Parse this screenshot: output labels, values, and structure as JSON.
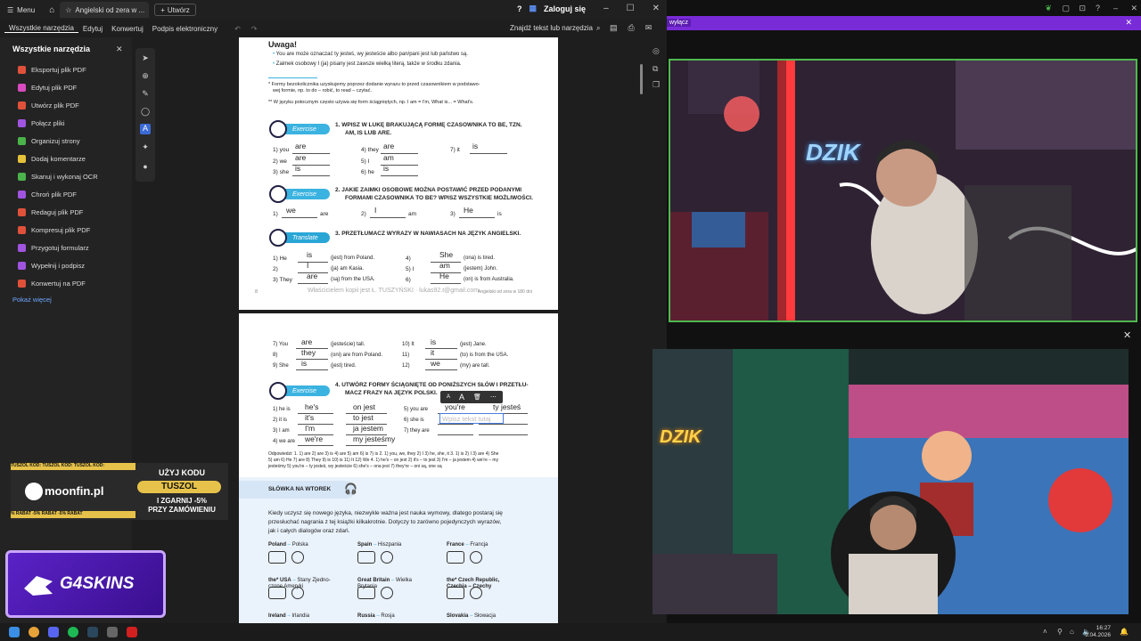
{
  "window": {
    "menu_label": "Menu",
    "tab_title": "Angielski od zera w ...",
    "new_tab_label": "Utwórz",
    "login_label": "Zaloguj się"
  },
  "toolbar": {
    "tabs": [
      "Wszystkie narzędzia",
      "Edytuj",
      "Konwertuj",
      "Podpis elektroniczny"
    ],
    "search_label": "Znajdź tekst lub narzędzia"
  },
  "panel": {
    "title": "Wszystkie narzędzia",
    "items": [
      {
        "label": "Eksportuj plik PDF",
        "color": "#e0513a"
      },
      {
        "label": "Edytuj plik PDF",
        "color": "#d94ac0"
      },
      {
        "label": "Utwórz plik PDF",
        "color": "#e0513a"
      },
      {
        "label": "Połącz pliki",
        "color": "#a154e0"
      },
      {
        "label": "Organizuj strony",
        "color": "#4ab34a"
      },
      {
        "label": "Dodaj komentarze",
        "color": "#e6c23a"
      },
      {
        "label": "Skanuj i wykonaj OCR",
        "color": "#4ab34a"
      },
      {
        "label": "Chroń plik PDF",
        "color": "#a154e0"
      },
      {
        "label": "Redaguj plik PDF",
        "color": "#e0513a"
      },
      {
        "label": "Kompresuj plik PDF",
        "color": "#e0513a"
      },
      {
        "label": "Przygotuj formularz",
        "color": "#a154e0"
      },
      {
        "label": "Wypełnij i podpisz",
        "color": "#a154e0"
      },
      {
        "label": "Konwertuj na PDF",
        "color": "#e0513a"
      }
    ],
    "more_label": "Pokaż więcej"
  },
  "page1": {
    "heading": "Uwaga!",
    "note1": "You are może oznaczać ty jesteś, wy jesteście albo pan/pani jest lub państwo są.",
    "note2": "Zaimek osobowy I (ja) pisany jest zawsze wielką literą, także w środku zdania.",
    "foot1a": "* Formy bezokolicznika uzyskujemy poprzez dodanie wyrazu to przed czasownikiem w podstawo-",
    "foot1b": "wej formie, np. to do – robić, to read – czytać.",
    "foot2": "** W języku potocznym często używa się form ściągniętych, np. I am = I'm, What is... = What's.",
    "ex1_badge": "Exercise",
    "ex1_title_a": "1. WPISZ W LUKĘ BRAKUJĄCĄ FORMĘ CZASOWNIKA TO BE, TZN.",
    "ex1_title_b": "AM, IS LUB ARE.",
    "ex1_rows": [
      {
        "label": "1) you",
        "answer": "are"
      },
      {
        "label": "2) we",
        "answer": "are"
      },
      {
        "label": "3) she",
        "answer": "is"
      },
      {
        "label": "4) they",
        "answer": "are"
      },
      {
        "label": "5) I",
        "answer": "am"
      },
      {
        "label": "6) he",
        "answer": "is"
      },
      {
        "label": "7) it",
        "answer": "is"
      }
    ],
    "ex2_badge": "Exercise",
    "ex2_title_a": "2. JAKIE ZAIMKI OSOBOWE MOŻNA POSTAWIĆ PRZED PODANYMI",
    "ex2_title_b": "FORMAMI CZASOWNIKA TO BE? WPISZ WSZYSTKIE MOŻLIWOŚCI.",
    "ex2_rows": [
      {
        "label": "1)",
        "answer": "we",
        "tail": "are"
      },
      {
        "label": "2)",
        "answer": "I",
        "tail": "am"
      },
      {
        "label": "3)",
        "answer": "He",
        "tail": "is"
      }
    ],
    "ex3_badge": "Translate",
    "ex3_title": "3. PRZETŁUMACZ WYRAZY W NAWIASACH NA JĘZYK ANGIELSKI.",
    "ex3_rows": [
      {
        "pre": "1) He",
        "answer": "is",
        "post": "(jest) from Poland."
      },
      {
        "pre": "2)",
        "answer": "I",
        "post": "(ja) am Kasia."
      },
      {
        "pre": "3) They",
        "answer": "are",
        "post": "(są) from the USA."
      },
      {
        "pre": "4)",
        "answer": "She",
        "post": "(ona) is tired."
      },
      {
        "pre": "5) I",
        "answer": "am",
        "post": "(jestem) John."
      },
      {
        "pre": "6)",
        "answer": "He",
        "post": "(on) is from Australia."
      }
    ],
    "page_num": "8",
    "watermark": "Właścicielem kopii jest Ł. TUSZYŃSKI · lukas92.t@gmail.com",
    "footer_right": "Angielski od zera w 180 dni"
  },
  "page2": {
    "rows_top": [
      {
        "pre": "7) You",
        "answer": "are",
        "post": "(jesteście) tall."
      },
      {
        "pre": "8)",
        "answer": "they",
        "post": "(oni) are from Poland."
      },
      {
        "pre": "9) She",
        "answer": "is",
        "post": "(jest) tired."
      },
      {
        "pre": "10) It",
        "answer": "is",
        "post": "(jest) Jane."
      },
      {
        "pre": "11)",
        "answer": "it",
        "post": "(to) is from the USA."
      },
      {
        "pre": "12)",
        "answer": "we",
        "post": "(my) are tall."
      }
    ],
    "ex4_badge": "Exercise",
    "ex4_title_a": "4. UTWÓRZ FORMY ŚCIĄGNIĘTE OD PONIŻSZYCH SŁÓW I PRZETŁU-",
    "ex4_title_b": "MACZ FRAZY NA JĘZYK POLSKI.",
    "ex4_left": [
      {
        "pre": "1) he is",
        "c": "he's",
        "t": "on jest"
      },
      {
        "pre": "2) it is",
        "c": "it's",
        "t": "to jest"
      },
      {
        "pre": "3) I am",
        "c": "I'm",
        "t": "ja jestem"
      },
      {
        "pre": "4) we are",
        "c": "we're",
        "t": "my jesteśmy"
      }
    ],
    "ex4_right": [
      {
        "pre": "5) you are",
        "c": "you're",
        "t": "ty jesteś"
      },
      {
        "pre": "6) she is",
        "c": "",
        "t": ""
      },
      {
        "pre": "7) they are",
        "c": "",
        "t": ""
      }
    ],
    "text_placeholder": "Wpisz tekst tutaj",
    "answers_a": "Odpowiedzi: 1. 1) are 2) are 3) is 4) are 5) am 6) is 7) is 2. 1) you, we, they 2) I 3) he, she, it 3. 1) is 2) I 3) are 4) She",
    "answers_b": "5) am 6) He 7) are 8) They 9) is 10) is 11) It 12) We 4. 1) he's – on jest 2) it's – to jest 3) I'm – ja jestem 4) we're – my",
    "answers_c": "jesteśmy 5) you're – ty jesteś, wy jesteście 6) she's – ona jest 7) they're – oni są, one są",
    "section_title": "SŁÓWKA NA WTOREK",
    "intro_a": "Kiedy uczysz się nowego języka, niezwykle ważna jest nauka wymowy, dlatego postaraj się",
    "intro_b": "przesłuchać nagrania z tej książki kilkakrotnie. Dotyczy to zarówno pojedynczych wyrazów,",
    "intro_c": "jak i całych dialogów oraz zdań.",
    "countries": [
      {
        "en": "Poland",
        "pl": "Polska"
      },
      {
        "en": "Spain",
        "pl": "Hiszpania"
      },
      {
        "en": "France",
        "pl": "Francja"
      },
      {
        "en": "the* USA",
        "pl": "Stany Zjedno-"
      },
      {
        "en": "Great Britain",
        "pl": "Wielka"
      },
      {
        "en": "the* Czech Republic,",
        "pl": ""
      },
      {
        "en": "Ireland",
        "pl": "Irlandia"
      },
      {
        "en": "Russia",
        "pl": "Rosja"
      },
      {
        "en": "Slovakia",
        "pl": "Słowacja"
      }
    ],
    "usa_cont": "czone Ameryki",
    "gb_cont": "Brytania",
    "cz_cont": "Czechia – Czechy"
  },
  "overlay": {
    "purple_label": "wyłącz",
    "promo_small": "TUSZOL KOD: TUSZOL KOD: TUSZOL KOD:",
    "promo_code_label": "UŻYJ KODU",
    "promo_code": "TUSZOL",
    "promo_sub_a": "I ZGARNIJ -5%",
    "promo_sub_b": "PRZY ZAMÓWIENIU",
    "promo_site": "moonfin.pl",
    "promo_strip": "% RABAT -5% RABAT -5% RABAT",
    "sponsor": "G4SKINS",
    "neon_text": "DZIK",
    "neon_text2": "DZIK"
  },
  "taskbar": {
    "time": "16:27",
    "date": "9.04.2026"
  }
}
